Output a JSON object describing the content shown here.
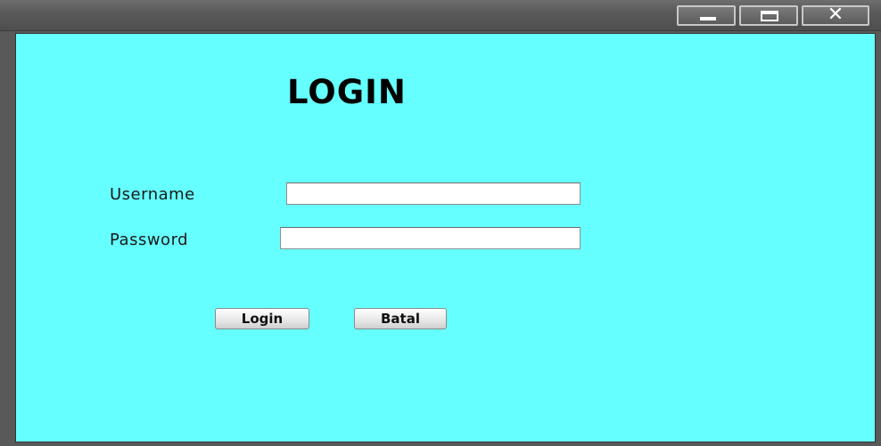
{
  "window": {
    "title": "",
    "controls": {
      "minimize": "minimize-icon",
      "maximize": "maximize-icon",
      "close": "close-icon"
    }
  },
  "form": {
    "heading": "LOGIN",
    "username": {
      "label": "Username",
      "value": "",
      "placeholder": ""
    },
    "password": {
      "label": "Password",
      "value": "",
      "placeholder": ""
    },
    "buttons": {
      "login": "Login",
      "cancel": "Batal"
    }
  },
  "colors": {
    "panel_background": "#66ffff",
    "window_frame": "#595959",
    "heading_text": "#000000"
  }
}
